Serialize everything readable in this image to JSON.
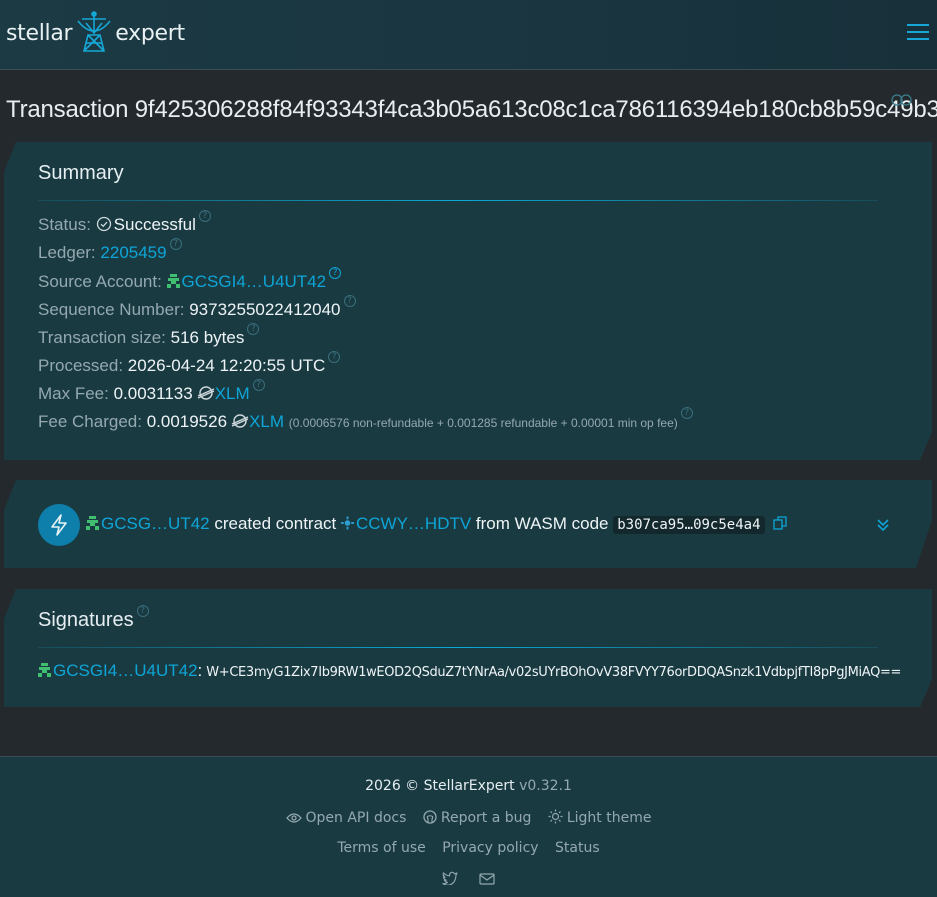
{
  "header": {
    "logo_left": "stellar",
    "logo_right": "expert",
    "logo_icon": "radio-telescope-icon",
    "menu_icon": "hamburger-menu-icon"
  },
  "page": {
    "title_prefix": "Transaction ",
    "tx_hash": "9f425306288f84f93343f4ca3b05a613c08c1ca786116394eb180cb8b59c49b3"
  },
  "summary": {
    "title": "Summary",
    "status_label": "Status:",
    "status_value": "Successful",
    "ledger_label": "Ledger:",
    "ledger_value": "2205459",
    "source_label": "Source Account:",
    "source_value": "GCSGI4…U4UT42",
    "sequence_label": "Sequence Number:",
    "sequence_value": "9373255022412040",
    "size_label": "Transaction size:",
    "size_value": "516 bytes",
    "processed_label": "Processed:",
    "processed_value": "2026-04-24 12:20:55 UTC",
    "max_fee_label": "Max Fee:",
    "max_fee_value": "0.0031133",
    "max_fee_asset": "XLM",
    "fee_charged_label": "Fee Charged:",
    "fee_charged_value": "0.0019526",
    "fee_charged_asset": "XLM",
    "fee_breakdown": "(0.0006576 non-refundable + 0.001285 refundable + 0.00001 min op fee)"
  },
  "operation": {
    "account": "GCSG…UT42",
    "action": " created contract ",
    "contract": "CCWY…HDTV",
    "from_text": " from WASM code ",
    "wasm_hash": "b307ca95…09c5e4a4"
  },
  "signatures": {
    "title": "Signatures",
    "signer": "GCSGI4…U4UT42",
    "colon": ":",
    "signature": "W+CE3myG1Zix7Ib9RW1wEOD2QSduZ7tYNrAa/v02sUYrBOhOvV38FVYY76orDDQASnzk1VdbpjfTI8pPgJMiAQ=="
  },
  "footer": {
    "copyright": "2026 © StellarExpert",
    "version": "v0.32.1",
    "api_docs": "Open API docs",
    "report_bug": "Report a bug",
    "light_theme": "Light theme",
    "terms": "Terms of use",
    "privacy": "Privacy policy",
    "status": "Status"
  },
  "colors": {
    "accent": "#0ea5d6",
    "account_green": "#3fbf6f",
    "card_bg": "#1a3a42",
    "page_bg": "#24292e"
  }
}
